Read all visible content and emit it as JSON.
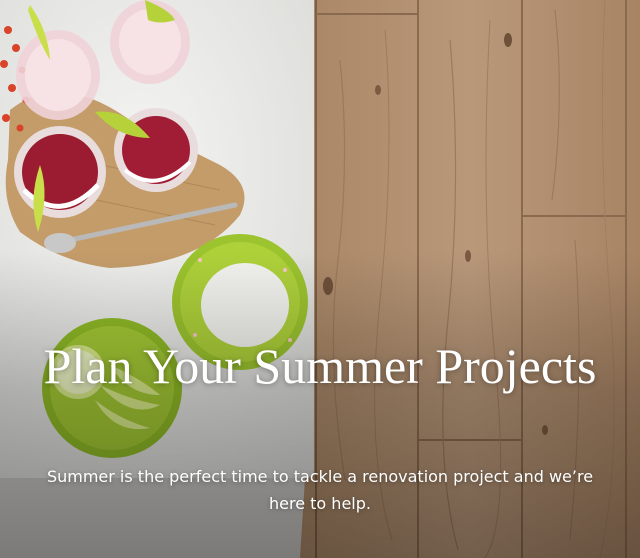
{
  "hero": {
    "title": "Plan Your Summer Projects",
    "subtitle": "Summer is the perfect time to tackle a renovation project and we’re here to help."
  },
  "colors": {
    "wood_floor": "#b3906f",
    "countertop": "#e9e9e6",
    "lime_plate": "#9cc42e",
    "drink": "#9b1b30",
    "text": "#ffffff"
  }
}
